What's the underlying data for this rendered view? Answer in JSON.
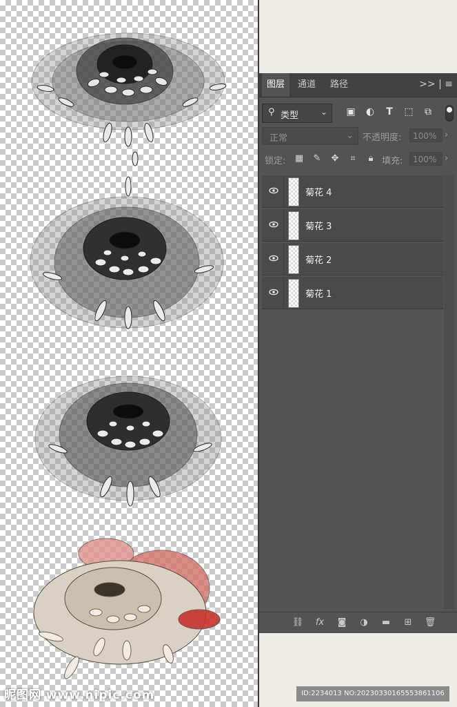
{
  "panel": {
    "tabs": [
      {
        "label": "图层",
        "active": true
      },
      {
        "label": "通道",
        "active": false
      },
      {
        "label": "路径",
        "active": false
      }
    ],
    "collapse_label": ">>",
    "filter": {
      "label": "类型"
    },
    "blend_mode": "正常",
    "opacity_label": "不透明度:",
    "opacity_value": "100%",
    "lock_label": "锁定:",
    "fill_label": "填充:",
    "fill_value": "100%",
    "layers": [
      {
        "name": "菊花 4",
        "visible": true
      },
      {
        "name": "菊花 3",
        "visible": true
      },
      {
        "name": "菊花 2",
        "visible": true
      },
      {
        "name": "菊花 1",
        "visible": true
      }
    ]
  },
  "watermark": {
    "logo_text": "昵图网 www.nipic.com",
    "id_text": "ID:2234013 NO:20230330165553861106"
  },
  "colors": {
    "panel_bg": "#535353",
    "tab_bar_bg": "#424242",
    "page_bg": "#efebe5",
    "flower_red": "#c8332b"
  },
  "icons": [
    "search-icon",
    "image-filter-icon",
    "adjustment-filter-icon",
    "type-filter-icon",
    "shape-filter-icon",
    "smart-object-filter-icon",
    "eye-icon",
    "lock-transparent-icon",
    "lock-paint-icon",
    "lock-move-icon",
    "lock-artboard-icon",
    "lock-all-icon",
    "link-icon",
    "fx-icon",
    "mask-icon",
    "adjustment-layer-icon",
    "folder-icon",
    "new-layer-icon",
    "trash-icon",
    "panel-menu-icon"
  ]
}
